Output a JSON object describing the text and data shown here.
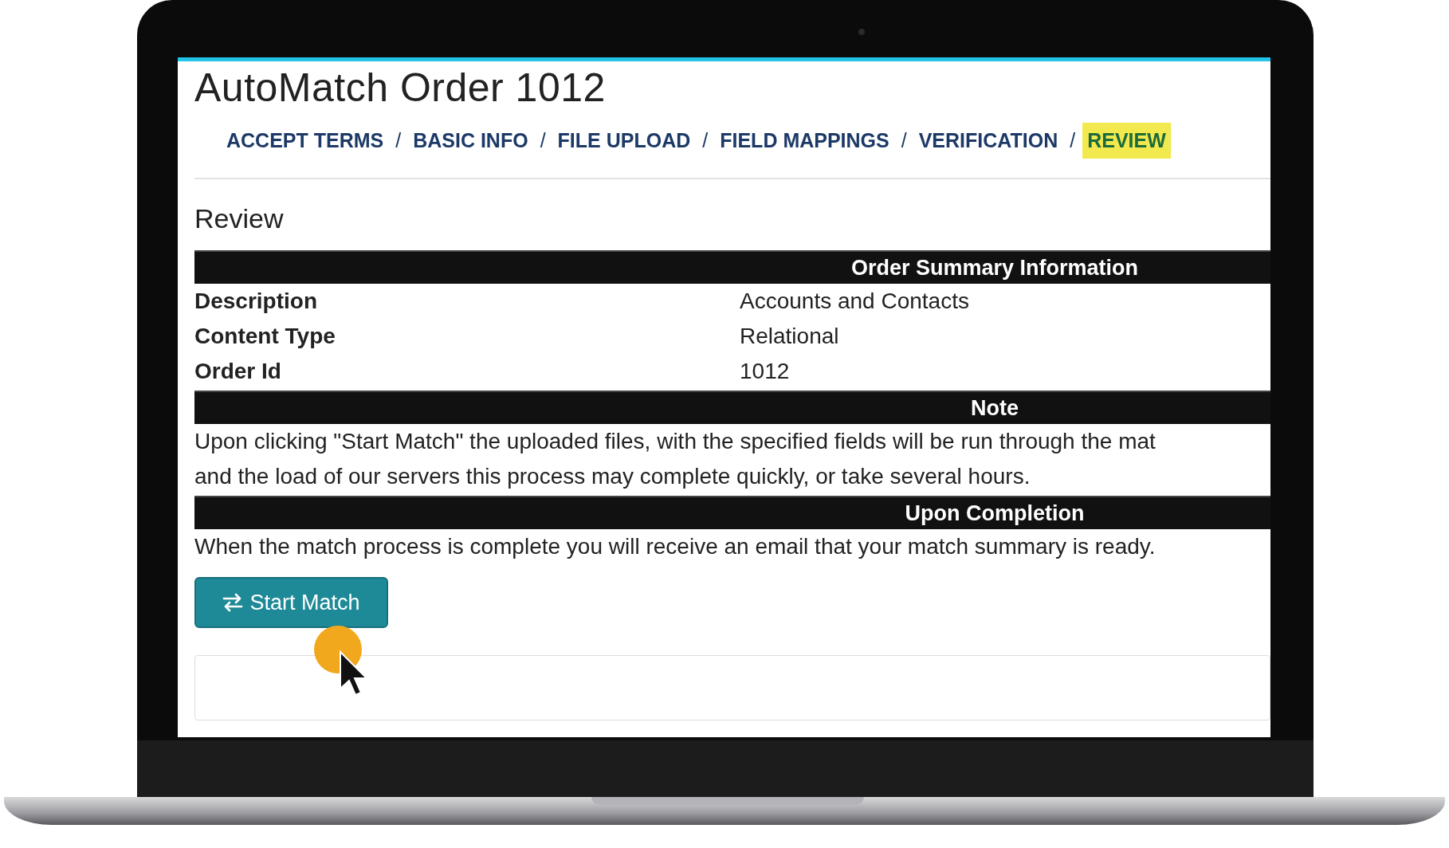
{
  "page": {
    "title": "AutoMatch Order 1012"
  },
  "breadcrumb": {
    "separator": "/",
    "steps": [
      {
        "label": "ACCEPT TERMS",
        "selected": false
      },
      {
        "label": "BASIC INFO",
        "selected": false
      },
      {
        "label": "FILE UPLOAD",
        "selected": false
      },
      {
        "label": "FIELD MAPPINGS",
        "selected": false
      },
      {
        "label": "VERIFICATION",
        "selected": false
      },
      {
        "label": "REVIEW",
        "selected": true
      }
    ]
  },
  "section_heading": "Review",
  "summary": {
    "header": "Order Summary Information",
    "rows": [
      {
        "label": "Description",
        "value": "Accounts and Contacts"
      },
      {
        "label": "Content Type",
        "value": "Relational"
      },
      {
        "label": "Order Id",
        "value": "1012"
      }
    ]
  },
  "note": {
    "header": "Note",
    "lines": [
      "Upon clicking \"Start Match\" the uploaded files, with the specified fields will be run through the mat",
      "and the load of our servers this process may complete quickly, or take several hours."
    ]
  },
  "completion": {
    "header": "Upon Completion",
    "text": "When the match process is complete you will receive an email that your match summary is ready."
  },
  "start_button": {
    "label": "Start Match"
  }
}
